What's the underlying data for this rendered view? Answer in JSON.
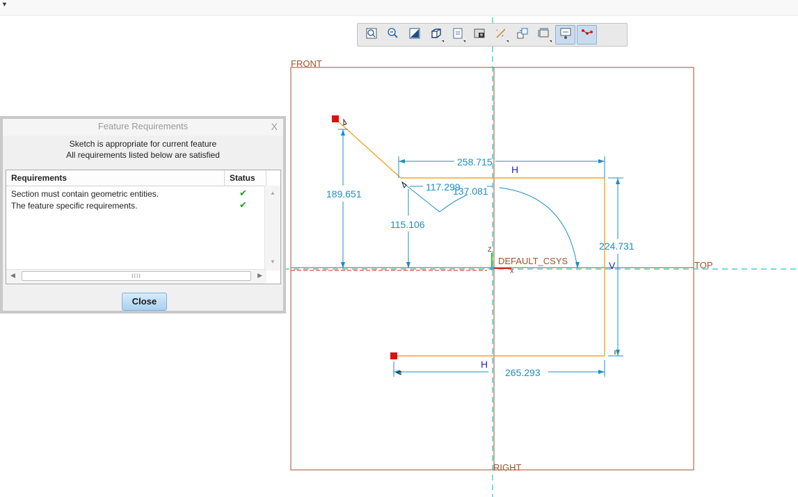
{
  "toolbar": {
    "buttons": [
      {
        "icon": "refit-icon",
        "active": false
      },
      {
        "icon": "zoom-out-icon",
        "active": false
      },
      {
        "icon": "repaint-icon",
        "active": false
      },
      {
        "icon": "display-style-icon",
        "active": false
      },
      {
        "icon": "saved-orientations-icon",
        "active": false
      },
      {
        "icon": "view-manager-icon",
        "active": false
      },
      {
        "icon": "datum-display-icon",
        "active": false
      },
      {
        "icon": "sketch-view-icon",
        "active": false
      },
      {
        "icon": "dimension-display-icon",
        "active": false
      },
      {
        "icon": "constraint-display-icon",
        "active": true
      },
      {
        "icon": "vertex-display-icon",
        "active": true
      }
    ]
  },
  "sketch": {
    "datum_labels": {
      "front": "FRONT",
      "top": "TOP",
      "right": "RIGHT"
    },
    "csys_label": "DEFAULT_CSYS",
    "axis_z": "Z",
    "axis_x": "X",
    "dimensions": [
      "258.715",
      "189.651",
      "117.299",
      "137.081",
      "115.106",
      "224.731",
      "265.293"
    ],
    "constraints": {
      "h_top": "H",
      "h_bottom": "H",
      "v_right": "V"
    },
    "colors": {
      "sketch": "#f5a623",
      "dimension": "#1a8fc6",
      "datum": "#a0522d",
      "endpoint": "#dd1111",
      "constraint": "#2222cc"
    }
  },
  "dialog": {
    "title": "Feature Requirements",
    "close_x": "X",
    "message_line1": "Sketch is appropriate for current feature",
    "message_line2": "All requirements listed below are satisfied",
    "columns": {
      "requirements": "Requirements",
      "status": "Status"
    },
    "rows": [
      {
        "text": "Section must contain geometric entities.",
        "status": "✔"
      },
      {
        "text": "The feature specific requirements.",
        "status": "✔"
      }
    ],
    "scroll_thumb": "IIII",
    "close_button": "Close"
  }
}
